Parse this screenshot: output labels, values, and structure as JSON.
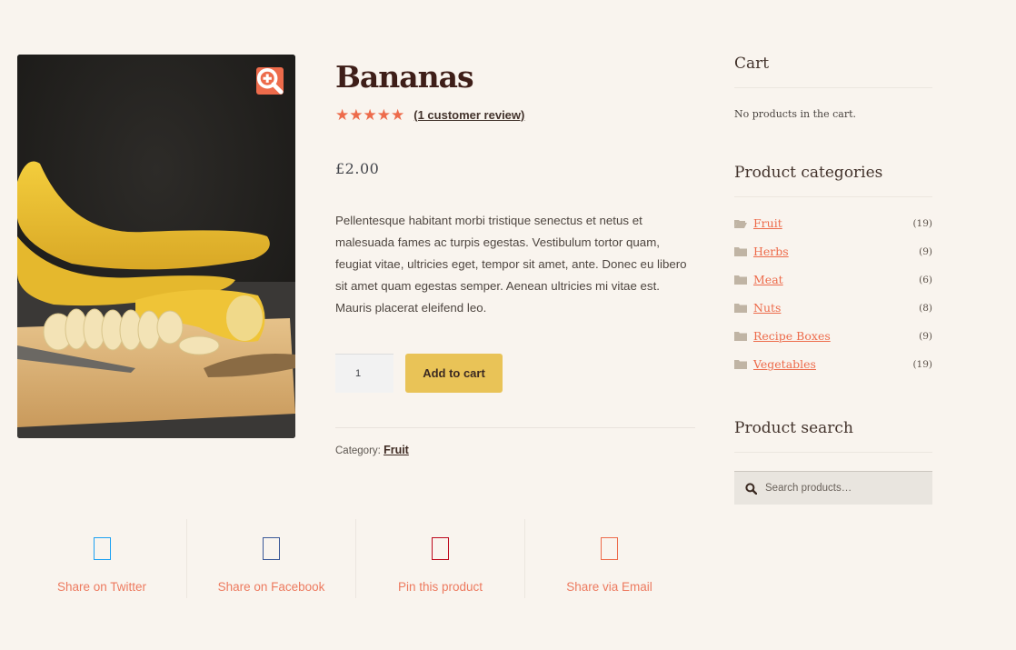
{
  "product": {
    "title": "Bananas",
    "rating": 5,
    "rating_max": 5,
    "review_link": "(1 customer review)",
    "price": "£2.00",
    "description": "Pellentesque habitant morbi tristique senectus et netus et malesuada fames ac turpis egestas. Vestibulum tortor quam, feugiat vitae, ultricies eget, tempor sit amet, ante. Donec eu libero sit amet quam egestas semper. Aenean ultricies mi vitae est. Mauris placerat eleifend leo.",
    "quantity": "1",
    "add_to_cart_label": "Add to cart",
    "category_label": "Category:",
    "category": "Fruit",
    "image_icon": "zoom-in-icon",
    "image_alt": "Bananas on a cutting board"
  },
  "share": [
    {
      "label": "Share on Twitter",
      "icon": "twitter-icon",
      "color": "#1da1f2"
    },
    {
      "label": "Share on Facebook",
      "icon": "facebook-icon",
      "color": "#3b5998"
    },
    {
      "label": "Pin this product",
      "icon": "pinterest-icon",
      "color": "#bd081c"
    },
    {
      "label": "Share via Email",
      "icon": "email-icon",
      "color": "#ed6b4b"
    }
  ],
  "sidebar": {
    "cart": {
      "title": "Cart",
      "empty_text": "No products in the cart."
    },
    "categories": {
      "title": "Product categories",
      "items": [
        {
          "label": "Fruit",
          "count": "(19)",
          "icon": "folder-open-icon"
        },
        {
          "label": "Herbs",
          "count": "(9)",
          "icon": "folder-icon"
        },
        {
          "label": "Meat",
          "count": "(6)",
          "icon": "folder-icon"
        },
        {
          "label": "Nuts",
          "count": "(8)",
          "icon": "folder-icon"
        },
        {
          "label": "Recipe Boxes",
          "count": "(9)",
          "icon": "folder-icon"
        },
        {
          "label": "Vegetables",
          "count": "(19)",
          "icon": "folder-icon"
        }
      ]
    },
    "search": {
      "title": "Product search",
      "placeholder": "Search products…"
    }
  },
  "colors": {
    "accent": "#ed6b4b",
    "button": "#e9c357",
    "background": "#f9f4ee",
    "heading": "#3e1e18"
  }
}
